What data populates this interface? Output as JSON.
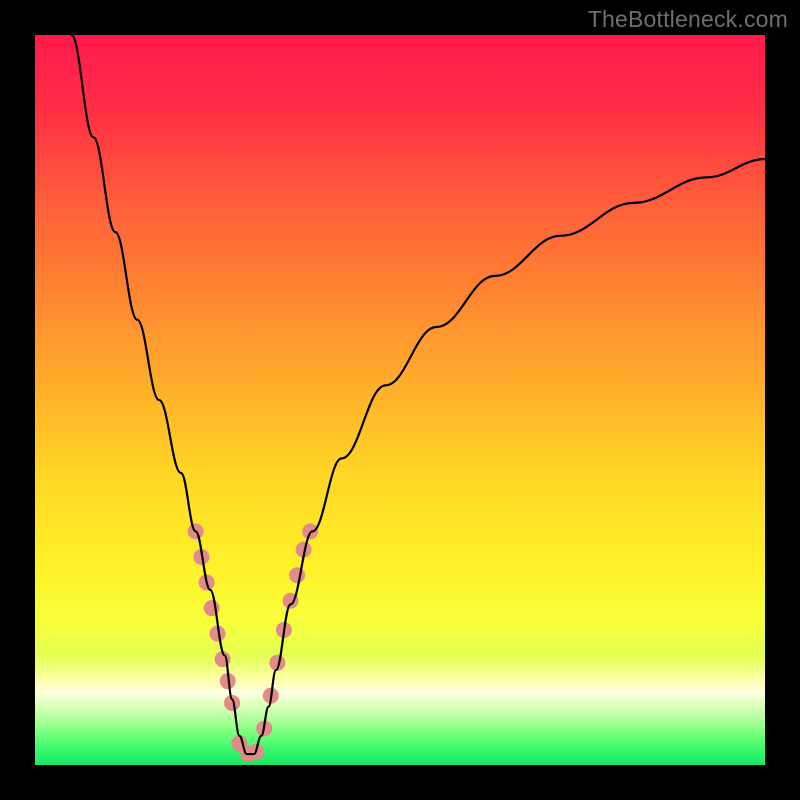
{
  "watermark": "TheBottleneck.com",
  "gradient": {
    "stops": [
      {
        "offset": "0%",
        "color": "#ff1a4b"
      },
      {
        "offset": "10%",
        "color": "#ff2e45"
      },
      {
        "offset": "22%",
        "color": "#ff5a3a"
      },
      {
        "offset": "35%",
        "color": "#ff8432"
      },
      {
        "offset": "48%",
        "color": "#ffae2b"
      },
      {
        "offset": "60%",
        "color": "#ffd626"
      },
      {
        "offset": "72%",
        "color": "#fff028"
      },
      {
        "offset": "80%",
        "color": "#f8ff3a"
      },
      {
        "offset": "85%",
        "color": "#e4ff52"
      },
      {
        "offset": "88%",
        "color": "#fbffa0"
      },
      {
        "offset": "90%",
        "color": "#ffffe0"
      },
      {
        "offset": "92%",
        "color": "#d8ffb8"
      },
      {
        "offset": "94%",
        "color": "#a8ff95"
      },
      {
        "offset": "96%",
        "color": "#6cff78"
      },
      {
        "offset": "98%",
        "color": "#35f86b"
      },
      {
        "offset": "100%",
        "color": "#18e765"
      }
    ]
  },
  "chart_data": {
    "type": "line",
    "title": "",
    "xlabel": "",
    "ylabel": "",
    "xlim": [
      0,
      100
    ],
    "ylim": [
      0,
      100
    ],
    "comment": "V-shaped bottleneck curve. y ≈ percentage bottleneck (100=red top, 0=green bottom). Minimum near x≈29.",
    "series": [
      {
        "name": "bottleneck-curve",
        "x": [
          5,
          8,
          11,
          14,
          17,
          20,
          22,
          24,
          26,
          27,
          28,
          29,
          30,
          31,
          32,
          33,
          35,
          38,
          42,
          48,
          55,
          63,
          72,
          82,
          92,
          100
        ],
        "y": [
          100,
          86,
          73,
          61,
          50,
          40,
          32,
          24,
          15,
          9,
          4,
          1.5,
          1.5,
          4,
          8,
          13,
          22,
          32,
          42,
          52,
          60,
          67,
          72.5,
          77,
          80.5,
          83
        ]
      }
    ],
    "highlight_dots": {
      "name": "highlight",
      "color": "#e38a8a",
      "radius_px": 8,
      "x": [
        22.0,
        22.8,
        23.5,
        24.2,
        25.0,
        25.7,
        26.4,
        27.0,
        28.0,
        29.2,
        30.3,
        31.4,
        32.3,
        33.2,
        34.1,
        35.0,
        35.9,
        36.8,
        37.7
      ],
      "y": [
        32.0,
        28.5,
        25.0,
        21.5,
        18.0,
        14.5,
        11.5,
        8.5,
        3.0,
        1.5,
        1.8,
        5.0,
        9.5,
        14.0,
        18.5,
        22.5,
        26.0,
        29.5,
        32.0
      ]
    }
  }
}
